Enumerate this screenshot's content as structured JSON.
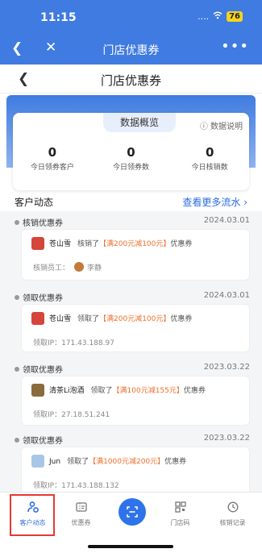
{
  "status": {
    "time": "11:15",
    "signal": "....",
    "wifi": "wifi-icon",
    "battery": "76"
  },
  "appbar": {
    "title": "门店优惠券",
    "more": "•••"
  },
  "page": {
    "title": "门店优惠券"
  },
  "overview": {
    "title": "数据概览",
    "help": "数据说明",
    "stats": [
      {
        "value": "0",
        "label": "今日领券客户"
      },
      {
        "value": "0",
        "label": "今日领券数"
      },
      {
        "value": "0",
        "label": "今日核销数"
      }
    ]
  },
  "section": {
    "title": "客户动态",
    "more": "查看更多流水 ›"
  },
  "entries": [
    {
      "type": "核销优惠券",
      "date": "2024.03.01",
      "user": "苍山雪",
      "action": "核销了",
      "coupon": "【满200元减100元】",
      "suffix": "优惠券",
      "meta_label": "核销员工：",
      "meta_value": "李静",
      "avatar_color": "#d6453a"
    },
    {
      "type": "领取优惠券",
      "date": "2024.03.01",
      "user": "苍山雪",
      "action": "领取了",
      "coupon": "【满200元减100元】",
      "suffix": "优惠券",
      "meta_label": "领取IP：",
      "meta_value": "171.43.188.97",
      "avatar_color": "#d6453a"
    },
    {
      "type": "领取优惠券",
      "date": "2023.03.22",
      "user": "清茶Li泡酒",
      "action": "领取了",
      "coupon": "【满100元减155元】",
      "suffix": "优惠券",
      "meta_label": "领取IP：",
      "meta_value": "27.18.51.241",
      "avatar_color": "#8a6b3b"
    },
    {
      "type": "领取优惠券",
      "date": "2023.03.22",
      "user": "Jun",
      "action": "领取了",
      "coupon": "【满1000元减200元】",
      "suffix": "优惠券",
      "meta_label": "领取IP：",
      "meta_value": "171.43.188.132",
      "avatar_color": "#a8c7e8"
    }
  ],
  "tabbar": {
    "tabs": [
      {
        "label": "客户动态",
        "icon": "customer-icon"
      },
      {
        "label": "优惠券",
        "icon": "coupon-icon"
      },
      {
        "label": "",
        "icon": "scan-icon"
      },
      {
        "label": "门店码",
        "icon": "qrcode-icon"
      },
      {
        "label": "核销记录",
        "icon": "history-icon"
      }
    ]
  },
  "colors": {
    "primary": "#3f7be0",
    "highlight": "#ee6e2b",
    "active": "#2f6fe0",
    "selection_box": "#e53935"
  }
}
